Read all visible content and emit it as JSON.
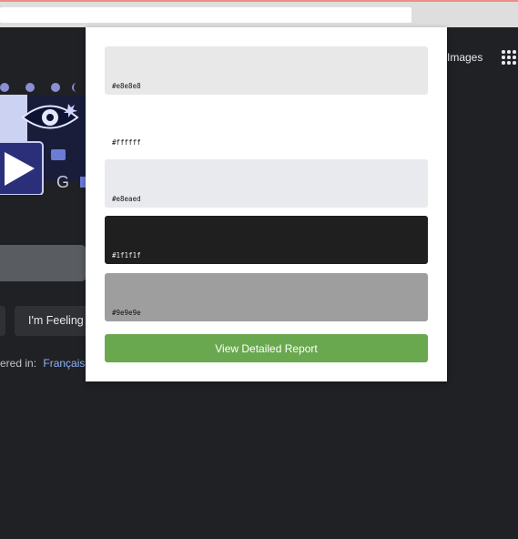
{
  "browser": {
    "address_value": ""
  },
  "google_page": {
    "images_link": "Images",
    "lucky_button": "I'm Feeling",
    "offered_in_prefix": "ered in:",
    "offered_language": "Français"
  },
  "popup": {
    "swatches": [
      {
        "hex": "#e8e8e8",
        "label": "#e8e8e8"
      },
      {
        "hex": "#ffffff",
        "label": "#ffffff"
      },
      {
        "hex": "#e8eaed",
        "label": "#e8eaed"
      },
      {
        "hex": "#1f1f1f",
        "label": "#1f1f1f"
      },
      {
        "hex": "#9e9e9e",
        "label": "#9e9e9e"
      }
    ],
    "report_button": "View Detailed Report",
    "report_button_color": "#6aa84f"
  }
}
